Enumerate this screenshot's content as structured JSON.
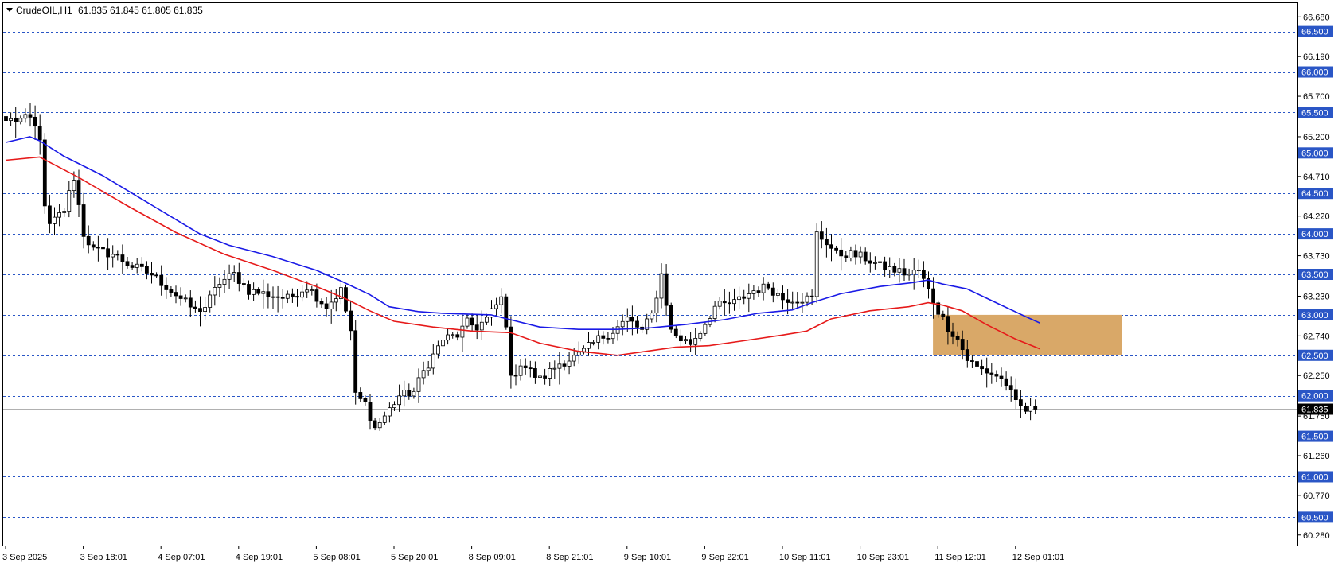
{
  "header": {
    "symbol_label": "CrudeOIL,H1",
    "ohlc_label": "61.835 61.845 61.805 61.835"
  },
  "colors": {
    "background": "#ffffff",
    "frame": "#000000",
    "grid": "#2a56c6",
    "ma_fast": "#1a1ae6",
    "ma_slow": "#e61a1a",
    "bull_fill": "#ffffff",
    "bear_fill": "#000000",
    "zone": "#d9a868",
    "price_line": "#b0b0b0",
    "level_label_bg": "#2a56c6",
    "current_label_bg": "#000000"
  },
  "chart_data": {
    "type": "candlestick",
    "ylim": [
      60.15,
      66.85
    ],
    "x_count": 217,
    "y_ticks": [
      "66.680",
      "66.190",
      "65.700",
      "65.200",
      "64.710",
      "64.220",
      "63.730",
      "63.230",
      "62.740",
      "62.250",
      "61.750",
      "61.260",
      "60.770",
      "60.280"
    ],
    "levels": [
      "66.500",
      "66.000",
      "65.500",
      "65.000",
      "64.500",
      "64.000",
      "63.500",
      "63.000",
      "62.500",
      "62.000",
      "61.500",
      "61.000",
      "60.500"
    ],
    "current_price": "61.835",
    "x_tick_labels": [
      {
        "index": 0,
        "label": "3 Sep 2025"
      },
      {
        "index": 16,
        "label": "3 Sep 18:01"
      },
      {
        "index": 32,
        "label": "4 Sep 07:01"
      },
      {
        "index": 48,
        "label": "4 Sep 19:01"
      },
      {
        "index": 64,
        "label": "5 Sep 08:01"
      },
      {
        "index": 80,
        "label": "5 Sep 20:01"
      },
      {
        "index": 96,
        "label": "8 Sep 09:01"
      },
      {
        "index": 112,
        "label": "8 Sep 21:01"
      },
      {
        "index": 128,
        "label": "9 Sep 10:01"
      },
      {
        "index": 144,
        "label": "9 Sep 22:01"
      },
      {
        "index": 160,
        "label": "10 Sep 11:01"
      },
      {
        "index": 176,
        "label": "10 Sep 23:01"
      },
      {
        "index": 192,
        "label": "11 Sep 12:01"
      },
      {
        "index": 208,
        "label": "12 Sep 01:01"
      }
    ],
    "close_anchors": [
      [
        0,
        65.4
      ],
      [
        5,
        65.42
      ],
      [
        7,
        65.2
      ],
      [
        8,
        64.3
      ],
      [
        9,
        64.1
      ],
      [
        12,
        64.3
      ],
      [
        14,
        64.7
      ],
      [
        16,
        64.0
      ],
      [
        18,
        63.8
      ],
      [
        22,
        63.75
      ],
      [
        26,
        63.6
      ],
      [
        30,
        63.5
      ],
      [
        34,
        63.3
      ],
      [
        36,
        63.2
      ],
      [
        39,
        63.05
      ],
      [
        41,
        63.1
      ],
      [
        44,
        63.4
      ],
      [
        47,
        63.5
      ],
      [
        50,
        63.3
      ],
      [
        54,
        63.25
      ],
      [
        58,
        63.2
      ],
      [
        62,
        63.35
      ],
      [
        66,
        63.1
      ],
      [
        69,
        63.3
      ],
      [
        71,
        62.8
      ],
      [
        72,
        62.0
      ],
      [
        74,
        61.9
      ],
      [
        76,
        61.6
      ],
      [
        78,
        61.75
      ],
      [
        81,
        62.0
      ],
      [
        84,
        62.05
      ],
      [
        86,
        62.3
      ],
      [
        88,
        62.5
      ],
      [
        90,
        62.7
      ],
      [
        93,
        62.75
      ],
      [
        95,
        62.9
      ],
      [
        97,
        62.85
      ],
      [
        99,
        62.95
      ],
      [
        102,
        63.2
      ],
      [
        103,
        62.9
      ],
      [
        104,
        62.2
      ],
      [
        106,
        62.4
      ],
      [
        110,
        62.2
      ],
      [
        114,
        62.4
      ],
      [
        118,
        62.5
      ],
      [
        122,
        62.7
      ],
      [
        125,
        62.8
      ],
      [
        128,
        62.95
      ],
      [
        131,
        62.8
      ],
      [
        133,
        63.0
      ],
      [
        135,
        63.5
      ],
      [
        137,
        62.8
      ],
      [
        139,
        62.7
      ],
      [
        141,
        62.65
      ],
      [
        143,
        62.8
      ],
      [
        146,
        63.1
      ],
      [
        150,
        63.15
      ],
      [
        154,
        63.3
      ],
      [
        157,
        63.35
      ],
      [
        160,
        63.2
      ],
      [
        163,
        63.2
      ],
      [
        166,
        63.2
      ],
      [
        167,
        64.0
      ],
      [
        169,
        63.9
      ],
      [
        171,
        63.75
      ],
      [
        174,
        63.75
      ],
      [
        177,
        63.7
      ],
      [
        180,
        63.6
      ],
      [
        183,
        63.55
      ],
      [
        186,
        63.5
      ],
      [
        188,
        63.55
      ],
      [
        190,
        63.3
      ],
      [
        192,
        63.05
      ],
      [
        194,
        62.85
      ],
      [
        196,
        62.7
      ],
      [
        198,
        62.45
      ],
      [
        200,
        62.35
      ],
      [
        202,
        62.3
      ],
      [
        204,
        62.25
      ],
      [
        206,
        62.15
      ],
      [
        208,
        61.9
      ],
      [
        210,
        61.82
      ],
      [
        212,
        61.835
      ]
    ],
    "zone": {
      "x_from": 191,
      "x_to": 230,
      "y_from": 62.5,
      "y_to": 63.0
    },
    "series": [
      {
        "type": "line",
        "color_key": "ma_fast",
        "points": [
          [
            0,
            65.13
          ],
          [
            5,
            65.2
          ],
          [
            7,
            65.15
          ],
          [
            12,
            64.96
          ],
          [
            20,
            64.72
          ],
          [
            30,
            64.36
          ],
          [
            40,
            64.0
          ],
          [
            46,
            63.86
          ],
          [
            55,
            63.72
          ],
          [
            64,
            63.55
          ],
          [
            69,
            63.42
          ],
          [
            75,
            63.25
          ],
          [
            79,
            63.1
          ],
          [
            85,
            63.04
          ],
          [
            90,
            63.02
          ],
          [
            100,
            63.0
          ],
          [
            110,
            62.85
          ],
          [
            118,
            62.82
          ],
          [
            126,
            62.82
          ],
          [
            133,
            62.84
          ],
          [
            140,
            62.88
          ],
          [
            148,
            62.94
          ],
          [
            155,
            63.02
          ],
          [
            162,
            63.06
          ],
          [
            166,
            63.15
          ],
          [
            172,
            63.26
          ],
          [
            180,
            63.35
          ],
          [
            187,
            63.4
          ],
          [
            190,
            63.43
          ],
          [
            193,
            63.38
          ],
          [
            198,
            63.32
          ],
          [
            204,
            63.15
          ],
          [
            210,
            62.98
          ],
          [
            213,
            62.9
          ]
        ]
      },
      {
        "type": "line",
        "color_key": "ma_slow",
        "points": [
          [
            0,
            64.91
          ],
          [
            7,
            64.95
          ],
          [
            15,
            64.7
          ],
          [
            25,
            64.35
          ],
          [
            35,
            64.02
          ],
          [
            45,
            63.75
          ],
          [
            55,
            63.55
          ],
          [
            64,
            63.35
          ],
          [
            70,
            63.2
          ],
          [
            75,
            63.05
          ],
          [
            80,
            62.92
          ],
          [
            88,
            62.85
          ],
          [
            96,
            62.8
          ],
          [
            104,
            62.78
          ],
          [
            110,
            62.65
          ],
          [
            118,
            62.55
          ],
          [
            126,
            62.5
          ],
          [
            132,
            62.55
          ],
          [
            138,
            62.6
          ],
          [
            145,
            62.62
          ],
          [
            152,
            62.68
          ],
          [
            160,
            62.75
          ],
          [
            165,
            62.8
          ],
          [
            170,
            62.95
          ],
          [
            178,
            63.05
          ],
          [
            186,
            63.1
          ],
          [
            190,
            63.15
          ],
          [
            193,
            63.12
          ],
          [
            197,
            63.05
          ],
          [
            202,
            62.88
          ],
          [
            208,
            62.7
          ],
          [
            213,
            62.58
          ]
        ]
      }
    ]
  }
}
